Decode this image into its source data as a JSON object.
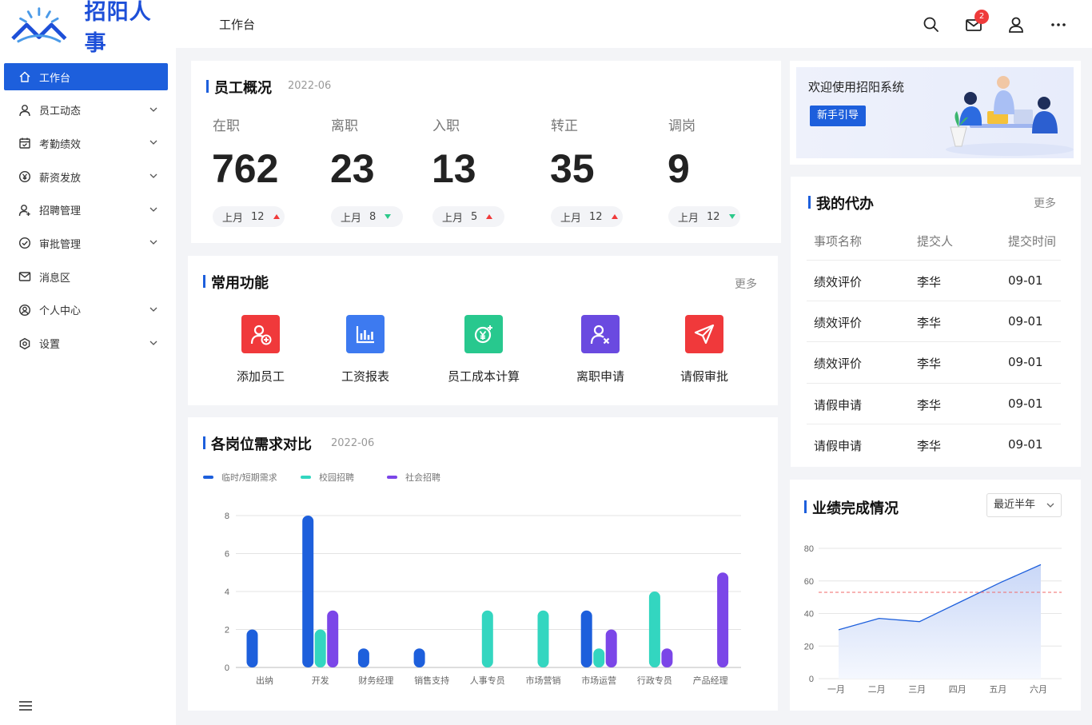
{
  "app": {
    "name": "招阳人事"
  },
  "header": {
    "title": "工作台",
    "mail_badge": "2"
  },
  "sidebar": {
    "items": [
      {
        "label": "工作台",
        "icon": "home-icon",
        "active": true,
        "expandable": false
      },
      {
        "label": "员工动态",
        "icon": "user-icon",
        "active": false,
        "expandable": true
      },
      {
        "label": "考勤绩效",
        "icon": "calendar-icon",
        "active": false,
        "expandable": true
      },
      {
        "label": "薪资发放",
        "icon": "yen-icon",
        "active": false,
        "expandable": true
      },
      {
        "label": "招聘管理",
        "icon": "user-add-icon",
        "active": false,
        "expandable": true
      },
      {
        "label": "审批管理",
        "icon": "check-circle-icon",
        "active": false,
        "expandable": true
      },
      {
        "label": "消息区",
        "icon": "mail-icon",
        "active": false,
        "expandable": false
      },
      {
        "label": "个人中心",
        "icon": "profile-icon",
        "active": false,
        "expandable": true
      },
      {
        "label": "设置",
        "icon": "settings-icon",
        "active": false,
        "expandable": true
      }
    ]
  },
  "overview": {
    "title": "员工概况",
    "date": "2022-06",
    "stats": [
      {
        "label": "在职",
        "value": "762",
        "prev_label": "上月",
        "prev_value": "12",
        "trend": "up",
        "trend_color": "#f03a3a"
      },
      {
        "label": "离职",
        "value": "23",
        "prev_label": "上月",
        "prev_value": "8",
        "trend": "down",
        "trend_color": "#2cc98a"
      },
      {
        "label": "入职",
        "value": "13",
        "prev_label": "上月",
        "prev_value": "5",
        "trend": "up",
        "trend_color": "#f03a3a"
      },
      {
        "label": "转正",
        "value": "35",
        "prev_label": "上月",
        "prev_value": "12",
        "trend": "up",
        "trend_color": "#f03a3a"
      },
      {
        "label": "调岗",
        "value": "9",
        "prev_label": "上月",
        "prev_value": "12",
        "trend": "down",
        "trend_color": "#2cc98a"
      }
    ]
  },
  "quick": {
    "title": "常用功能",
    "more": "更多",
    "items": [
      {
        "label": "添加员工",
        "icon": "add-user-icon",
        "color": "#f0393b"
      },
      {
        "label": "工资报表",
        "icon": "bar-chart-icon",
        "color": "#3d7af0"
      },
      {
        "label": "员工成本计算",
        "icon": "cost-icon",
        "color": "#28c88e"
      },
      {
        "label": "离职申请",
        "icon": "user-remove-icon",
        "color": "#6a4ae0"
      },
      {
        "label": "请假审批",
        "icon": "send-icon",
        "color": "#f0393b"
      }
    ]
  },
  "demand": {
    "title": "各岗位需求对比",
    "date": "2022-06"
  },
  "chart_data": [
    {
      "type": "bar",
      "title": "各岗位需求对比",
      "categories": [
        "出纳",
        "开发",
        "财务经理",
        "销售支持",
        "人事专员",
        "市场营销",
        "市场运营",
        "行政专员",
        "产品经理"
      ],
      "series": [
        {
          "name": "临时/短期需求",
          "color": "#1d5fdc",
          "values": [
            2,
            8,
            1,
            1,
            0,
            0,
            3,
            0,
            0
          ]
        },
        {
          "name": "校园招聘",
          "color": "#33d6c0",
          "values": [
            0,
            2,
            0,
            0,
            3,
            3,
            1,
            4,
            0
          ]
        },
        {
          "name": "社会招聘",
          "color": "#7b46e8",
          "values": [
            0,
            3,
            0,
            0,
            0,
            0,
            2,
            1,
            5
          ]
        }
      ],
      "yticks": [
        0,
        2,
        4,
        6,
        8
      ],
      "ylim": [
        0,
        8
      ],
      "legend_position": "top-left",
      "grid": true
    },
    {
      "type": "area",
      "title": "业绩完成情况",
      "categories": [
        "一月",
        "二月",
        "三月",
        "四月",
        "五月",
        "六月"
      ],
      "values": [
        30,
        37,
        35,
        47,
        59,
        70
      ],
      "target": 53,
      "yticks": [
        0,
        20,
        40,
        60,
        80
      ],
      "ylim": [
        0,
        80
      ],
      "line_color": "#1d5fdc",
      "target_color": "#f06a6a",
      "grid": true
    }
  ],
  "welcome": {
    "text": "欢迎使用招阳系统",
    "button": "新手引导"
  },
  "todo": {
    "title": "我的代办",
    "more": "更多",
    "columns": [
      "事项名称",
      "提交人",
      "提交时间"
    ],
    "rows": [
      [
        "绩效评价",
        "李华",
        "09-01"
      ],
      [
        "绩效评价",
        "李华",
        "09-01"
      ],
      [
        "绩效评价",
        "李华",
        "09-01"
      ],
      [
        "请假申请",
        "李华",
        "09-01"
      ],
      [
        "请假申请",
        "李华",
        "09-01"
      ]
    ]
  },
  "performance": {
    "title": "业绩完成情况",
    "range": "最近半年"
  }
}
